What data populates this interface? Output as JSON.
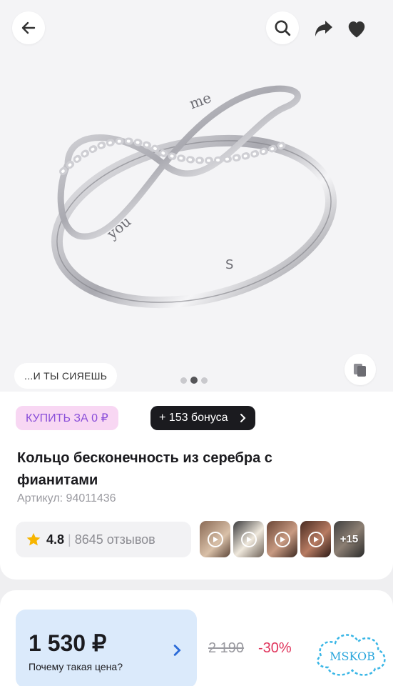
{
  "header": {
    "back_icon": "arrow-left-icon",
    "search_icon": "search-icon",
    "share_icon": "share-icon",
    "favorite_icon": "heart-icon"
  },
  "gallery": {
    "slogan": "...И ТЫ СИЯЕШЬ",
    "engraving_left": "you",
    "engraving_right": "me",
    "hallmark": "S",
    "page_count": 3,
    "active_page": 2,
    "copy_icon": "copy-icon"
  },
  "product": {
    "buy_label": "КУПИТЬ ЗА 0 ₽",
    "bonus_label": "+ 153 бонуса",
    "title_line1": "Кольцо бесконечность из серебра с",
    "title_line2": "фианитами",
    "sku": "Артикул: 94011436",
    "rating": "4.8",
    "separator": "|",
    "reviews": "8645 отзывов",
    "more_media": "+15"
  },
  "price": {
    "current": "1 530 ₽",
    "why_label": "Почему такая цена?",
    "old": "2 190",
    "discount": "-30%"
  },
  "watermark": {
    "text": "MSKOB"
  },
  "colors": {
    "accent_purple": "#8a4fd9",
    "pill_pink": "#f8d7f3",
    "price_box": "#dbeafb",
    "discount_red": "#e0345c",
    "star": "#f7b500"
  }
}
